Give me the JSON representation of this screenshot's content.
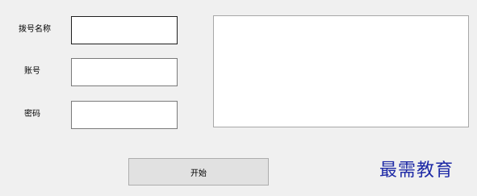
{
  "form": {
    "dial_name_label": "拨号名称",
    "dial_name_value": "",
    "account_label": "账号",
    "account_value": "",
    "password_label": "密码",
    "password_value": ""
  },
  "log": {
    "value": ""
  },
  "actions": {
    "start_label": "开始"
  },
  "watermark": {
    "text": "最需教育"
  }
}
